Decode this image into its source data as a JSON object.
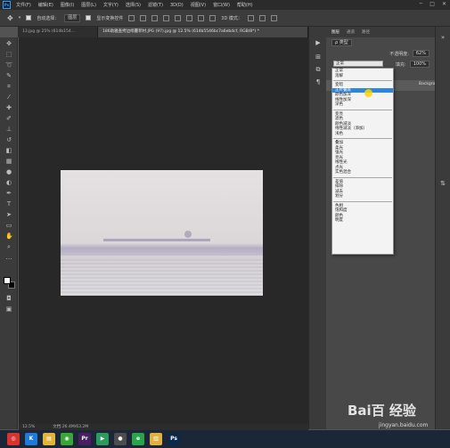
{
  "app": {
    "logo_text": "Ps"
  },
  "menubar": {
    "items": [
      "文件(F)",
      "编辑(E)",
      "图像(I)",
      "图层(L)",
      "文字(Y)",
      "选择(S)",
      "滤镜(T)",
      "3D(D)",
      "视图(V)",
      "窗口(W)",
      "帮助(H)"
    ]
  },
  "optionsbar": {
    "auto_select_label": "自动选择：",
    "auto_select_value": "图层",
    "transform_label": "显示变换控件",
    "mode_3d_label": "3D 模式："
  },
  "tabs": [
    {
      "label": "13.jpg @ 25% (614b154...",
      "active": false
    },
    {
      "label": "186助雅查拷边绢薹菲材.JPG (97).jpg @ 12.5% (614b5546bc7a6ebdcf, RGB/8*) *",
      "active": true
    }
  ],
  "status": {
    "zoom": "12.5%",
    "doc_size": "文档:26.4M/63.2M"
  },
  "layers_panel": {
    "tabs": [
      "图层",
      "通道",
      "路径"
    ],
    "filter_label": "ρ 类型",
    "blend_mode": "正常",
    "opacity_label": "不透明度:",
    "opacity_value": "62%",
    "fill_label": "填充:",
    "fill_value": "100%",
    "layer_name": "Background"
  },
  "blend_menu": {
    "groups": [
      [
        "正常",
        "溶解"
      ],
      [
        "变暗",
        "正片叠底",
        "颜色加深",
        "线性加深",
        "深色"
      ],
      [
        "变亮",
        "滤色",
        "颜色减淡",
        "线性减淡（添加）",
        "浅色"
      ],
      [
        "叠加",
        "柔光",
        "强光",
        "亮光",
        "线性光",
        "点光",
        "实色混合"
      ],
      [
        "差值",
        "排除",
        "减去",
        "划分"
      ],
      [
        "色相",
        "饱和度",
        "颜色",
        "明度"
      ]
    ],
    "selected": "正片叠底"
  },
  "watermark": {
    "main": "Bai百 经验",
    "sub": "jingyan.baidu.com"
  },
  "taskbar": {
    "icons": [
      {
        "name": "start-icon",
        "glyph": "◎",
        "color": "#d8332c"
      },
      {
        "name": "app-k-icon",
        "glyph": "K",
        "color": "#1f7ad9"
      },
      {
        "name": "folder-icon",
        "glyph": "▤",
        "color": "#e1b43a"
      },
      {
        "name": "wechat-icon",
        "glyph": "◉",
        "color": "#3aa63a"
      },
      {
        "name": "premiere-icon",
        "glyph": "Pr",
        "color": "#4a1e63"
      },
      {
        "name": "media-icon",
        "glyph": "▶",
        "color": "#2c9a5c"
      },
      {
        "name": "camera-icon",
        "glyph": "●",
        "color": "#4d4d4d"
      },
      {
        "name": "app-green-icon",
        "glyph": "e",
        "color": "#2aa34a"
      },
      {
        "name": "explorer-icon",
        "glyph": "▥",
        "color": "#e0b040"
      },
      {
        "name": "photoshop-icon",
        "glyph": "Ps",
        "color": "#0b2a4a"
      }
    ]
  }
}
